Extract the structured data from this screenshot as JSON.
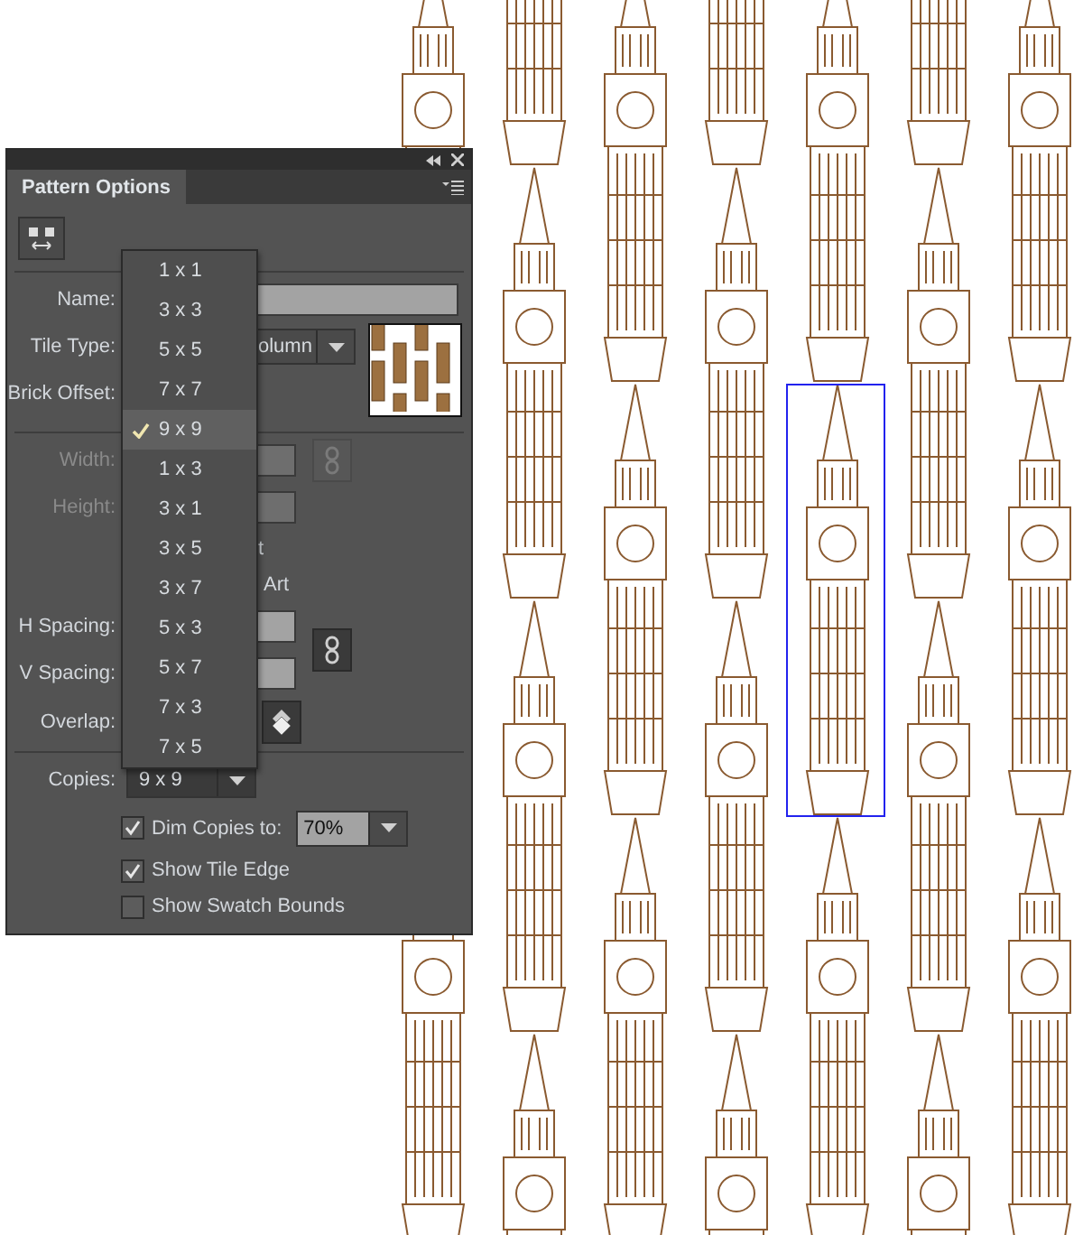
{
  "panel": {
    "tab": "Pattern Options"
  },
  "name_row": {
    "label": "Name:"
  },
  "tile_type": {
    "label": "Tile Type:",
    "value": "olumn"
  },
  "brick_offset": {
    "label": "Brick Offset:"
  },
  "width": {
    "label": "Width:",
    "disabled": true
  },
  "height": {
    "label": "Height:",
    "disabled": true
  },
  "partial_options": [
    "t",
    "Art"
  ],
  "h_spacing": {
    "label": "H Spacing:"
  },
  "v_spacing": {
    "label": "V Spacing:"
  },
  "overlap": {
    "label": "Overlap:"
  },
  "copies": {
    "label": "Copies:",
    "value": "9 x 9"
  },
  "copies_menu": [
    {
      "label": "1 x 1",
      "selected": false
    },
    {
      "label": "3 x 3",
      "selected": false
    },
    {
      "label": "5 x 5",
      "selected": false
    },
    {
      "label": "7 x 7",
      "selected": false
    },
    {
      "label": "9 x 9",
      "selected": true
    },
    {
      "label": "1 x 3",
      "selected": false
    },
    {
      "label": "3 x 1",
      "selected": false
    },
    {
      "label": "3 x 5",
      "selected": false
    },
    {
      "label": "3 x 7",
      "selected": false
    },
    {
      "label": "5 x 3",
      "selected": false
    },
    {
      "label": "5 x 7",
      "selected": false
    },
    {
      "label": "7 x 3",
      "selected": false
    },
    {
      "label": "7 x 5",
      "selected": false
    }
  ],
  "dim_copies": {
    "label": "Dim Copies to:",
    "checked": true,
    "value": "70%"
  },
  "show_tile_edge": {
    "label": "Show Tile Edge",
    "checked": true
  },
  "show_swatch_bounds": {
    "label": "Show Swatch Bounds",
    "checked": false
  }
}
